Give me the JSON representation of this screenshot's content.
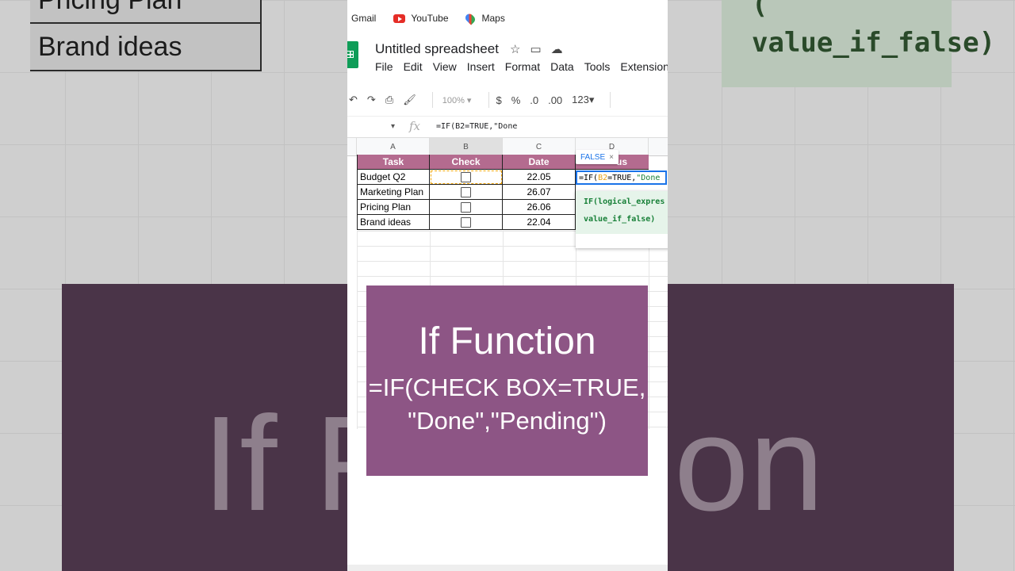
{
  "background": {
    "left_cells": [
      "Pricing Plan",
      "Brand ideas"
    ],
    "right_formula_top": "(",
    "right_formula": "value_if_false)",
    "big_text_left": "If F",
    "big_text_right": "on"
  },
  "browser": {
    "bookmarks": [
      {
        "label": "Gmail",
        "icon": "gmail-icon"
      },
      {
        "label": "YouTube",
        "icon": "youtube-icon"
      },
      {
        "label": "Maps",
        "icon": "maps-icon"
      }
    ]
  },
  "sheets": {
    "title": "Untitled spreadsheet",
    "menu": [
      "File",
      "Edit",
      "View",
      "Insert",
      "Format",
      "Data",
      "Tools",
      "Extensions"
    ],
    "toolbar": {
      "zoom": "100%",
      "currency": "$",
      "percent": "%",
      "decrease_decimal": ".0",
      "increase_decimal": ".00",
      "number_format": "123"
    },
    "formula_bar": {
      "fx": "fx",
      "content": "=IF(B2=TRUE,\"Done"
    },
    "columns": [
      "A",
      "B",
      "C",
      "D"
    ],
    "headers": {
      "task": "Task",
      "check": "Check",
      "date": "Date",
      "status_fragment": "us"
    },
    "rows": [
      {
        "task": "Budget Q2",
        "date": "22.05"
      },
      {
        "task": "Marketing Plan",
        "date": "26.07"
      },
      {
        "task": "Pricing Plan",
        "date": "26.06"
      },
      {
        "task": "Brand ideas",
        "date": "22.04"
      }
    ],
    "edit_cell": {
      "p1": "=IF(",
      "ref": "B2",
      "p2": "=TRUE,",
      "str": "\"Done"
    },
    "false_chip": {
      "label": "FALSE",
      "close": "×"
    },
    "hint": {
      "line1": "IF(logical_expres",
      "line2": "value_if_false)"
    }
  },
  "overlay": {
    "title": "If Function",
    "formula_line1": "=IF(CHECK BOX=TRUE,",
    "formula_line2": "\"Done\",\"Pending\")"
  },
  "colors": {
    "header_purple": "#b46b8f",
    "card_purple": "#8d5585",
    "selection_blue": "#1a73e8",
    "formula_green": "#188038"
  }
}
